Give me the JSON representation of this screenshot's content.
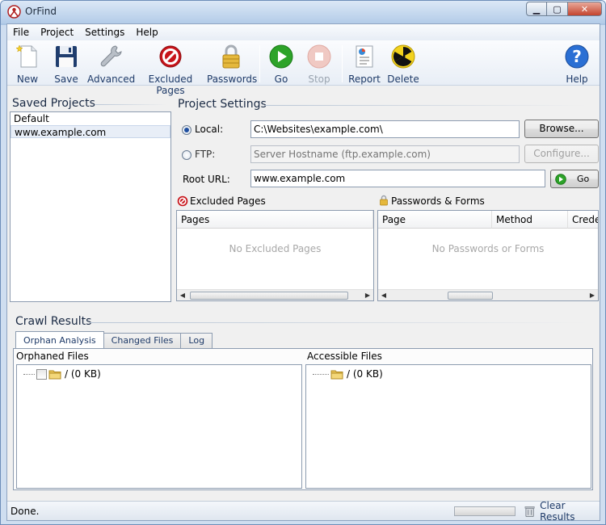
{
  "window": {
    "title": "OrFind"
  },
  "menu": [
    "File",
    "Project",
    "Settings",
    "Help"
  ],
  "toolbar": {
    "new": "New",
    "save": "Save",
    "advanced": "Advanced",
    "excluded_pages": "Excluded Pages",
    "passwords": "Passwords",
    "go": "Go",
    "stop": "Stop",
    "report": "Report",
    "delete": "Delete",
    "help": "Help"
  },
  "saved_projects": {
    "title": "Saved Projects",
    "items": [
      "Default",
      "www.example.com"
    ],
    "selected": 1
  },
  "project_settings": {
    "title": "Project Settings",
    "local_label": "Local:",
    "local_value": "C:\\Websites\\example.com\\",
    "browse_label": "Browse...",
    "ftp_label": "FTP:",
    "ftp_placeholder": "Server Hostname (ftp.example.com)",
    "configure_label": "Configure...",
    "root_url_label": "Root URL:",
    "root_url_value": "www.example.com",
    "go_label": "Go",
    "selected_mode": "local"
  },
  "excluded_pages": {
    "title": "Excluded Pages",
    "column": "Pages",
    "empty_text": "No Excluded Pages"
  },
  "passwords_forms": {
    "title": "Passwords & Forms",
    "columns": [
      "Page",
      "Method",
      "Crede"
    ],
    "empty_text": "No Passwords or Forms"
  },
  "crawl_results": {
    "title": "Crawl Results",
    "tabs": [
      "Orphan Analysis",
      "Changed Files",
      "Log"
    ],
    "active_tab": 0,
    "orphaned": {
      "title": "Orphaned Files",
      "root": "/ (0 KB)"
    },
    "accessible": {
      "title": "Accessible Files",
      "root": "/ (0 KB)"
    }
  },
  "status": {
    "text": "Done.",
    "clear_label": "Clear Results"
  }
}
